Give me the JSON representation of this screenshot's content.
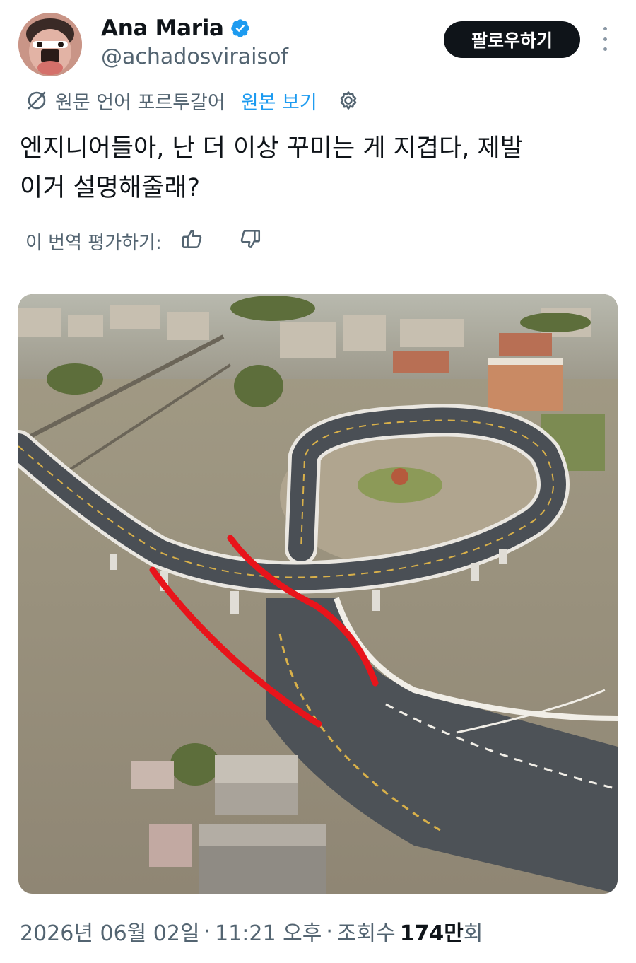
{
  "author": {
    "display_name": "Ana Maria",
    "handle": "@achadosviraisof",
    "verified": true
  },
  "follow_button": {
    "label": "팔로우하기"
  },
  "translation": {
    "source_label": "원문 언어 포르투갈어",
    "show_original": "원본 보기"
  },
  "tweet": {
    "text_line1": "엔지니어들아, 난 더 이상 꾸미는 게 지겹다, 제발",
    "text_line2": "이거 설명해줄래?"
  },
  "rate_translation": {
    "label": "이 번역 평가하기:"
  },
  "meta": {
    "date": "2026년 06월 02일",
    "separator1": "·",
    "time": "11:21 오후",
    "separator2": "·",
    "views_label": "조회수",
    "views_count": "174만",
    "views_suffix": "회"
  },
  "colors": {
    "text_primary": "#0f1419",
    "text_secondary": "#536471",
    "link": "#1d9bf0",
    "verified_badge": "#1d9bf0",
    "annotation_red": "#e8141b"
  },
  "icons": {
    "verified": "verified-badge-icon",
    "more": "more-dots-vertical-icon",
    "translate": "translate-slash-icon",
    "settings": "gear-icon",
    "thumb_up": "thumbs-up-icon",
    "thumb_down": "thumbs-down-icon"
  }
}
